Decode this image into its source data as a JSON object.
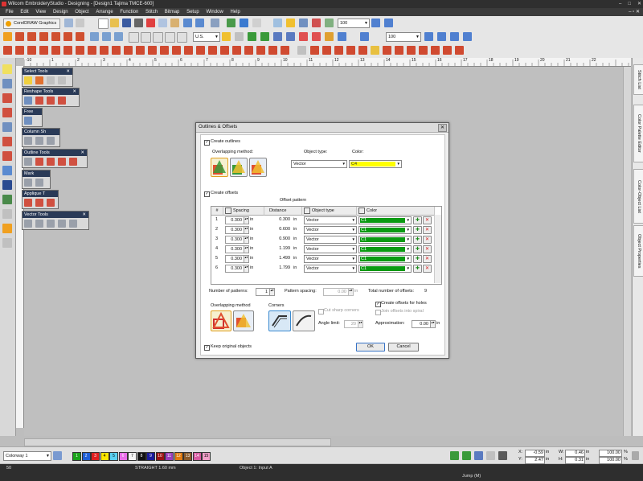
{
  "title_bar": {
    "text": "Wilcom EmbroideryStudio - Designing - [Design1           Tajima TMCE-600]",
    "controls": [
      "–",
      "□",
      "✕"
    ]
  },
  "menu": {
    "items": [
      "File",
      "Edit",
      "View",
      "Design",
      "Object",
      "Arrange",
      "Function",
      "Stitch",
      "Bitmap",
      "Setup",
      "Window",
      "Help"
    ],
    "right": "– ▫ ✕"
  },
  "toolbar": {
    "coreldraw_label": "CorelDRAW Graphics",
    "zoom_value_1": "100",
    "units_value": "U.S.",
    "zoom_value_2": "100"
  },
  "ruler": {
    "marks": [
      "-10",
      "1",
      "2",
      "3",
      "4",
      "5",
      "6",
      "7",
      "8",
      "9",
      "10",
      "11",
      "12",
      "13",
      "14",
      "15",
      "16",
      "17",
      "18",
      "19",
      "20",
      "21",
      "22"
    ]
  },
  "palettes": [
    {
      "title": "Select Tools"
    },
    {
      "title": "Reshape Tools"
    },
    {
      "title": "Free"
    },
    {
      "title": "Column Sh"
    },
    {
      "title": "Outline Tools"
    },
    {
      "title": "Mark"
    },
    {
      "title": "Applique T"
    },
    {
      "title": "Vector Tools"
    }
  ],
  "right_tabs": [
    "Stitch List",
    "Color Palette Editor",
    "Color-Object List",
    "Object Properties"
  ],
  "dialog": {
    "title": "Outlines & Offsets",
    "close": "✕",
    "create_outlines_label": "Create outlines",
    "overlapping_method_label": "Overlapping method:",
    "object_type_label": "Object type:",
    "object_type_value": "Vector",
    "color_label": "Color:",
    "color_value": "C4",
    "create_offsets_label": "Create offsets",
    "offset_pattern_label": "Offset pattern",
    "columns": {
      "num": "#",
      "spacing": "Spacing",
      "distance": "Distance",
      "object_type": "Object type",
      "color": "Color"
    },
    "rows": [
      {
        "n": "1",
        "spacing": "0.300",
        "unit": "in",
        "distance": "0.300",
        "dunit": "in",
        "type": "Vector",
        "color": "C1"
      },
      {
        "n": "2",
        "spacing": "0.300",
        "unit": "in",
        "distance": "0.600",
        "dunit": "in",
        "type": "Vector",
        "color": "C1"
      },
      {
        "n": "3",
        "spacing": "0.300",
        "unit": "in",
        "distance": "0.900",
        "dunit": "in",
        "type": "Vector",
        "color": "C1"
      },
      {
        "n": "4",
        "spacing": "0.300",
        "unit": "in",
        "distance": "1.199",
        "dunit": "in",
        "type": "Vector",
        "color": "C1"
      },
      {
        "n": "5",
        "spacing": "0.300",
        "unit": "in",
        "distance": "1.499",
        "dunit": "in",
        "type": "Vector",
        "color": "C1"
      },
      {
        "n": "6",
        "spacing": "0.300",
        "unit": "in",
        "distance": "1.799",
        "dunit": "in",
        "type": "Vector",
        "color": "C1"
      }
    ],
    "number_of_patterns_label": "Number of patterns:",
    "number_of_patterns_value": "1",
    "pattern_spacing_label": "Pattern spacing:",
    "pattern_spacing_value": "0.00",
    "pattern_spacing_unit": "in",
    "total_offsets_label": "Total number of offsets:",
    "total_offsets_value": "9",
    "overlapping_method2_label": "Overlapping method",
    "corners_label": "Corners",
    "cut_sharp_corners_label": "Cut sharp corners",
    "angle_limit_label": "Angle limit:",
    "angle_limit_value": "20",
    "create_offsets_holes_label": "Create offsets for holes",
    "join_offsets_spiral_label": "Join offsets into spiral",
    "approximation_label": "Approximation:",
    "approximation_value": "0.00",
    "approximation_unit": "in",
    "keep_original_label": "Keep original objects",
    "ok_label": "OK",
    "cancel_label": "Cancel",
    "colors": {
      "c1": "#0a9a12",
      "c4": "#ffff00"
    }
  },
  "status": {
    "colorway": "Colorway 1",
    "swatches": [
      {
        "n": "1",
        "c": "#1aa31a"
      },
      {
        "n": "2",
        "c": "#1f5fd6"
      },
      {
        "n": "3",
        "c": "#e02020"
      },
      {
        "n": "4",
        "c": "#ffe600"
      },
      {
        "n": "5",
        "c": "#5ad1f2"
      },
      {
        "n": "6",
        "c": "#e86de8"
      },
      {
        "n": "7",
        "c": "#f4f4f4"
      },
      {
        "n": "8",
        "c": "#111111"
      },
      {
        "n": "9",
        "c": "#1b1b9a"
      },
      {
        "n": "10",
        "c": "#9a1212"
      },
      {
        "n": "11",
        "c": "#9a3dbb"
      },
      {
        "n": "12",
        "c": "#e07a10"
      },
      {
        "n": "13",
        "c": "#8a5a2a"
      },
      {
        "n": "14",
        "c": "#d65aa0"
      },
      {
        "n": "15",
        "c": "#f0a0c8"
      }
    ],
    "x_label": "X:",
    "x_value": "-0.59",
    "x_unit": "in",
    "y_label": "Y:",
    "y_value": "2.47",
    "y_unit": "in",
    "w_label": "W:",
    "w_value": "0.46",
    "w_unit": "in",
    "h_label": "H:",
    "h_value": "0.31",
    "h_unit": "in",
    "sx_value": "100.00",
    "sx_unit": "%",
    "sy_value": "100.00",
    "sy_unit": "%"
  },
  "bottom_bar": {
    "stitch_count": "50",
    "stitch_type": "STRAIGHT  1.60 mm",
    "object_info": "Object 1: Input A",
    "mode": "Jump (M)"
  }
}
